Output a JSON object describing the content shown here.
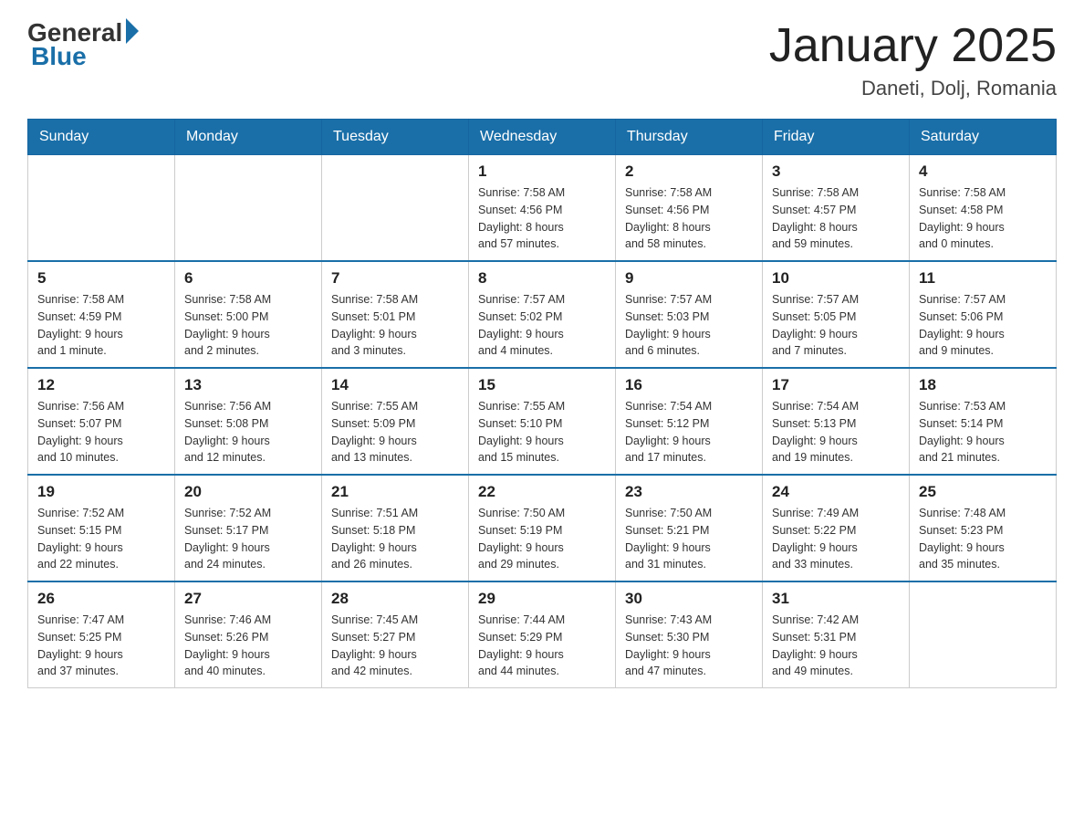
{
  "logo": {
    "general": "General",
    "blue": "Blue"
  },
  "title": "January 2025",
  "subtitle": "Daneti, Dolj, Romania",
  "weekdays": [
    "Sunday",
    "Monday",
    "Tuesday",
    "Wednesday",
    "Thursday",
    "Friday",
    "Saturday"
  ],
  "weeks": [
    [
      {
        "day": "",
        "info": ""
      },
      {
        "day": "",
        "info": ""
      },
      {
        "day": "",
        "info": ""
      },
      {
        "day": "1",
        "info": "Sunrise: 7:58 AM\nSunset: 4:56 PM\nDaylight: 8 hours\nand 57 minutes."
      },
      {
        "day": "2",
        "info": "Sunrise: 7:58 AM\nSunset: 4:56 PM\nDaylight: 8 hours\nand 58 minutes."
      },
      {
        "day": "3",
        "info": "Sunrise: 7:58 AM\nSunset: 4:57 PM\nDaylight: 8 hours\nand 59 minutes."
      },
      {
        "day": "4",
        "info": "Sunrise: 7:58 AM\nSunset: 4:58 PM\nDaylight: 9 hours\nand 0 minutes."
      }
    ],
    [
      {
        "day": "5",
        "info": "Sunrise: 7:58 AM\nSunset: 4:59 PM\nDaylight: 9 hours\nand 1 minute."
      },
      {
        "day": "6",
        "info": "Sunrise: 7:58 AM\nSunset: 5:00 PM\nDaylight: 9 hours\nand 2 minutes."
      },
      {
        "day": "7",
        "info": "Sunrise: 7:58 AM\nSunset: 5:01 PM\nDaylight: 9 hours\nand 3 minutes."
      },
      {
        "day": "8",
        "info": "Sunrise: 7:57 AM\nSunset: 5:02 PM\nDaylight: 9 hours\nand 4 minutes."
      },
      {
        "day": "9",
        "info": "Sunrise: 7:57 AM\nSunset: 5:03 PM\nDaylight: 9 hours\nand 6 minutes."
      },
      {
        "day": "10",
        "info": "Sunrise: 7:57 AM\nSunset: 5:05 PM\nDaylight: 9 hours\nand 7 minutes."
      },
      {
        "day": "11",
        "info": "Sunrise: 7:57 AM\nSunset: 5:06 PM\nDaylight: 9 hours\nand 9 minutes."
      }
    ],
    [
      {
        "day": "12",
        "info": "Sunrise: 7:56 AM\nSunset: 5:07 PM\nDaylight: 9 hours\nand 10 minutes."
      },
      {
        "day": "13",
        "info": "Sunrise: 7:56 AM\nSunset: 5:08 PM\nDaylight: 9 hours\nand 12 minutes."
      },
      {
        "day": "14",
        "info": "Sunrise: 7:55 AM\nSunset: 5:09 PM\nDaylight: 9 hours\nand 13 minutes."
      },
      {
        "day": "15",
        "info": "Sunrise: 7:55 AM\nSunset: 5:10 PM\nDaylight: 9 hours\nand 15 minutes."
      },
      {
        "day": "16",
        "info": "Sunrise: 7:54 AM\nSunset: 5:12 PM\nDaylight: 9 hours\nand 17 minutes."
      },
      {
        "day": "17",
        "info": "Sunrise: 7:54 AM\nSunset: 5:13 PM\nDaylight: 9 hours\nand 19 minutes."
      },
      {
        "day": "18",
        "info": "Sunrise: 7:53 AM\nSunset: 5:14 PM\nDaylight: 9 hours\nand 21 minutes."
      }
    ],
    [
      {
        "day": "19",
        "info": "Sunrise: 7:52 AM\nSunset: 5:15 PM\nDaylight: 9 hours\nand 22 minutes."
      },
      {
        "day": "20",
        "info": "Sunrise: 7:52 AM\nSunset: 5:17 PM\nDaylight: 9 hours\nand 24 minutes."
      },
      {
        "day": "21",
        "info": "Sunrise: 7:51 AM\nSunset: 5:18 PM\nDaylight: 9 hours\nand 26 minutes."
      },
      {
        "day": "22",
        "info": "Sunrise: 7:50 AM\nSunset: 5:19 PM\nDaylight: 9 hours\nand 29 minutes."
      },
      {
        "day": "23",
        "info": "Sunrise: 7:50 AM\nSunset: 5:21 PM\nDaylight: 9 hours\nand 31 minutes."
      },
      {
        "day": "24",
        "info": "Sunrise: 7:49 AM\nSunset: 5:22 PM\nDaylight: 9 hours\nand 33 minutes."
      },
      {
        "day": "25",
        "info": "Sunrise: 7:48 AM\nSunset: 5:23 PM\nDaylight: 9 hours\nand 35 minutes."
      }
    ],
    [
      {
        "day": "26",
        "info": "Sunrise: 7:47 AM\nSunset: 5:25 PM\nDaylight: 9 hours\nand 37 minutes."
      },
      {
        "day": "27",
        "info": "Sunrise: 7:46 AM\nSunset: 5:26 PM\nDaylight: 9 hours\nand 40 minutes."
      },
      {
        "day": "28",
        "info": "Sunrise: 7:45 AM\nSunset: 5:27 PM\nDaylight: 9 hours\nand 42 minutes."
      },
      {
        "day": "29",
        "info": "Sunrise: 7:44 AM\nSunset: 5:29 PM\nDaylight: 9 hours\nand 44 minutes."
      },
      {
        "day": "30",
        "info": "Sunrise: 7:43 AM\nSunset: 5:30 PM\nDaylight: 9 hours\nand 47 minutes."
      },
      {
        "day": "31",
        "info": "Sunrise: 7:42 AM\nSunset: 5:31 PM\nDaylight: 9 hours\nand 49 minutes."
      },
      {
        "day": "",
        "info": ""
      }
    ]
  ]
}
